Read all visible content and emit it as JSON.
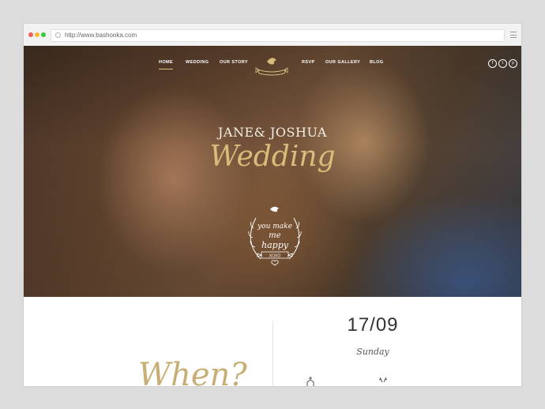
{
  "browser": {
    "url": "http://www.bashooka.com"
  },
  "nav": {
    "home": "HOME",
    "wedding": "WEDDING",
    "our_story": "OUR STORY",
    "rsvp": "RSVP",
    "our_gallery": "OUR GALLERY",
    "blog": "BLOG"
  },
  "social": {
    "facebook": "f",
    "twitter": "t",
    "pinterest": "p"
  },
  "hero": {
    "names": "JANE& JOSHUA",
    "title": "Wedding",
    "badge_line1": "you make",
    "badge_line2": "me",
    "badge_line3": "happy",
    "badge_ribbon": "XOXO"
  },
  "event": {
    "date": "17/09",
    "day": "Sunday",
    "when_heading": "When?"
  },
  "colors": {
    "gold": "#d6bd7c",
    "nav_underline": "#d9c08a"
  }
}
